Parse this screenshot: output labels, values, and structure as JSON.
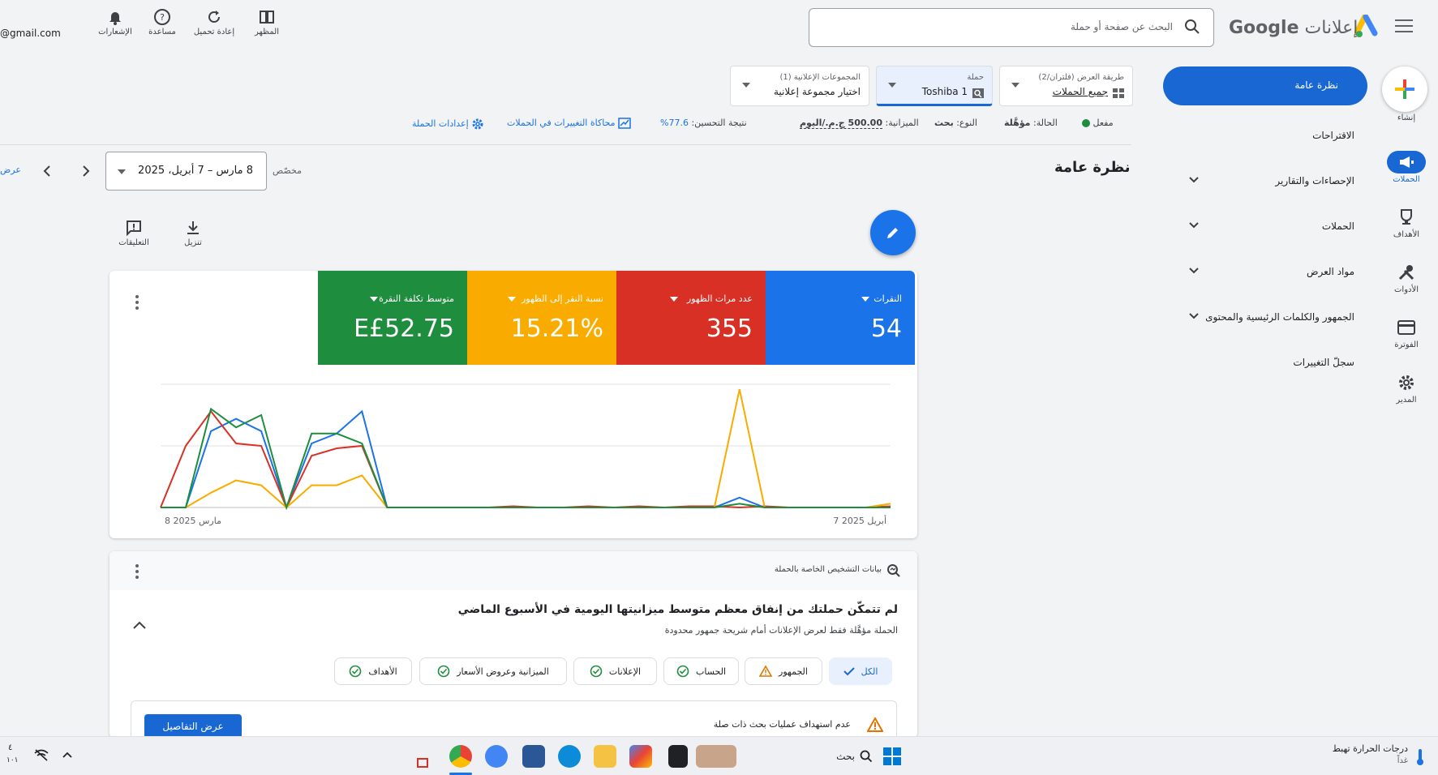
{
  "header": {
    "brand_google": "Google",
    "brand_ads": "إعلانات",
    "search_placeholder": "البحث عن صفحة أو حملة",
    "tools": [
      "المظهر",
      "إعادة تحميل",
      "مساعدة",
      "الإشعارات"
    ],
    "email": "@gmail.com"
  },
  "rail": {
    "create": "إنشاء",
    "items": [
      "الحملات",
      "الأهداف",
      "الأدوات",
      "الفوترة",
      "المدير"
    ]
  },
  "nav": {
    "active": "نظرة عامة",
    "items": [
      "الاقتراحات",
      "الإحصاءات والتقارير",
      "الحملات",
      "مواد العرض",
      "الجمهور والكلمات الرئيسية والمحتوى",
      "سجلّ التغييرات"
    ]
  },
  "selectors": {
    "view_label": "طريقة العرض (فلتران/2)",
    "view_value": "جميع الحملات",
    "campaign_label": "حملة",
    "campaign_value": "Toshiba 1",
    "adgroup_label": "المجموعات الإعلانية (1)",
    "adgroup_value": "اختيار مجموعة إعلانية"
  },
  "status": {
    "enabled": "مفعل",
    "state_label": "الحالة:",
    "state_value": "مؤهَّلة",
    "type_label": "النوع:",
    "type_value": "بحث",
    "budget_label": "الميزانية:",
    "budget_value": "500.00 ج.م./اليوم",
    "score_label": "نتيجة التحسين:",
    "score_value": "77.6%",
    "simulator": "محاكاة التغييرات في الحملات",
    "settings": "إعدادات الحملة"
  },
  "page": {
    "title": "نظرة عامة",
    "custom": "مخصّص",
    "date_range": "8 مارس – 7 أبريل، 2025",
    "view_left": "عرض",
    "download": "تنزيل",
    "comments": "التعليقات"
  },
  "metrics": [
    {
      "name": "النقرات",
      "value": "54",
      "color": "#1a73e8"
    },
    {
      "name": "عدد مرات الظهور",
      "value": "355",
      "color": "#d93025"
    },
    {
      "name": "نسبة النقر إلى الظهور",
      "value": "15.21%",
      "color": "#f9ab00"
    },
    {
      "name": "متوسط تكلفة النقرة",
      "value": "E£52.75",
      "color": "#1e8e3e"
    }
  ],
  "chart_data": {
    "type": "line",
    "x_start_label": "8 مارس 2025",
    "x_end_label": "7 أبريل 2025",
    "series": [
      {
        "name": "النقرات",
        "color": "#1a73e8",
        "values": [
          0,
          0,
          62,
          72,
          62,
          0,
          52,
          60,
          78,
          0,
          0,
          0,
          0,
          0,
          0,
          0,
          0,
          0,
          0,
          0,
          0,
          0,
          0,
          8,
          0,
          0,
          0,
          0,
          0,
          0
        ]
      },
      {
        "name": "عدد مرات الظهور",
        "color": "#d93025",
        "values": [
          0,
          50,
          78,
          52,
          50,
          0,
          42,
          48,
          50,
          0,
          0,
          0,
          0,
          0,
          1,
          0,
          0,
          1,
          0,
          1,
          0,
          1,
          1,
          0,
          1,
          0,
          0,
          0,
          0,
          1
        ]
      },
      {
        "name": "نسبة النقر إلى الظهور",
        "color": "#f9ab00",
        "values": [
          0,
          0,
          12,
          22,
          18,
          0,
          18,
          18,
          26,
          0,
          0,
          0,
          0,
          0,
          0,
          0,
          0,
          0,
          0,
          0,
          0,
          0,
          0,
          96,
          0,
          0,
          0,
          0,
          0,
          3
        ]
      },
      {
        "name": "متوسط تكلفة النقرة",
        "color": "#1e8e3e",
        "values": [
          0,
          0,
          80,
          65,
          75,
          0,
          60,
          60,
          52,
          0,
          0,
          0,
          0,
          0,
          0,
          0,
          0,
          0,
          0,
          0,
          0,
          0,
          0,
          3,
          0,
          0,
          0,
          0,
          0,
          0
        ]
      }
    ]
  },
  "diagnostics": {
    "header": "بيانات التشخيص الخاصة بالحملة",
    "title": "لم تتمكّن حملتك من إنفاق معظم متوسط ميزانيتها اليومية في الأسبوع الماضي",
    "subtitle": "الحملة مؤهَّلة فقط لعرض الإعلانات أمام شريحة جمهور محدودة",
    "chips": [
      "الكل",
      "الجمهور",
      "الحساب",
      "الإعلانات",
      "الميزانية وعروض الأسعار",
      "الأهداف"
    ],
    "issue": "عدم استهداف عمليات بحث ذات صلة",
    "details_button": "عرض التفاصيل"
  },
  "taskbar": {
    "weather_line1": "درجات الحرارة تهبط",
    "weather_line2": "غداً",
    "search": "بحث",
    "time1": "٤",
    "time2": "١٠١"
  }
}
